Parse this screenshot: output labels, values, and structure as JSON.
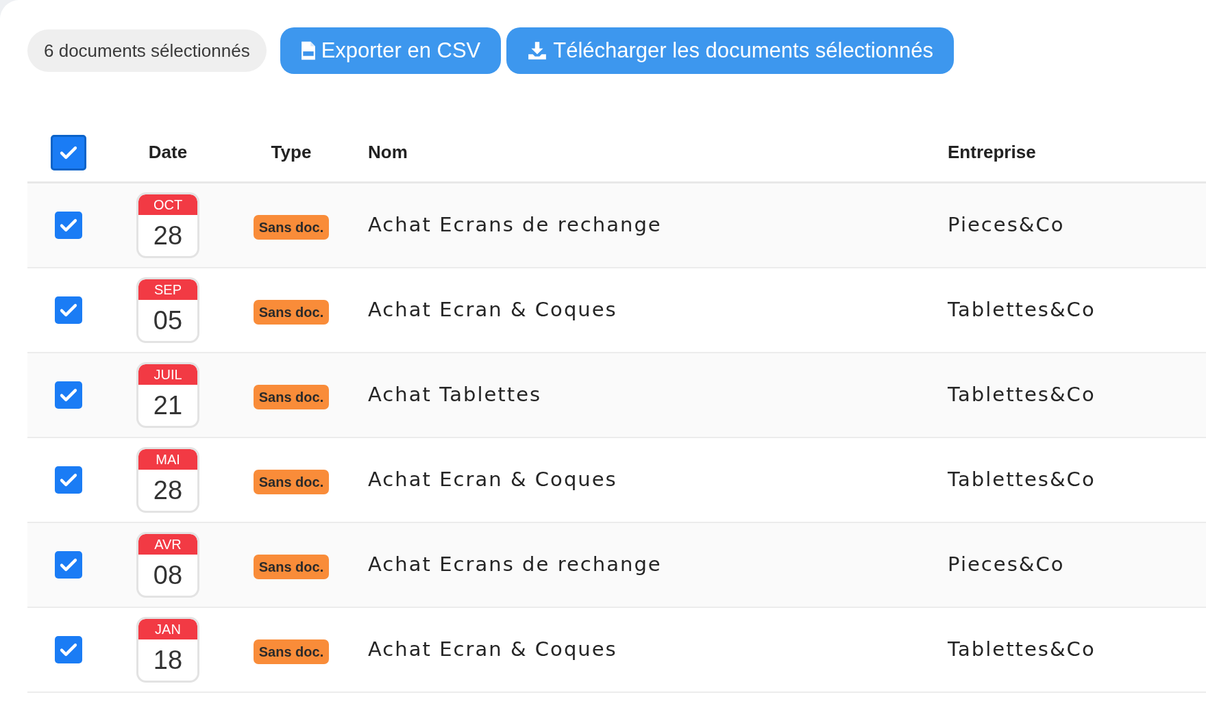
{
  "selection_count": "6 documents sélectionnés",
  "actions": [
    {
      "kind": "csv",
      "label": "Exporter en CSV"
    },
    {
      "kind": "download",
      "label": "Télécharger les documents sélectionnés"
    }
  ],
  "table": {
    "select_all": {
      "checked": true
    },
    "columns": [
      "Date",
      "Type",
      "Nom",
      "Entreprise"
    ],
    "rows": [
      {
        "checked": true,
        "month": "OCT",
        "day": "28",
        "type": "Sans doc.",
        "name": "Achat Ecrans de rechange",
        "company": "Pieces&Co"
      },
      {
        "checked": true,
        "month": "SEP",
        "day": "05",
        "type": "Sans doc.",
        "name": "Achat Ecran & Coques",
        "company": "Tablettes&Co"
      },
      {
        "checked": true,
        "month": "JUIL",
        "day": "21",
        "type": "Sans doc.",
        "name": "Achat Tablettes",
        "company": "Tablettes&Co"
      },
      {
        "checked": true,
        "month": "MAI",
        "day": "28",
        "type": "Sans doc.",
        "name": "Achat Ecran & Coques",
        "company": "Tablettes&Co"
      },
      {
        "checked": true,
        "month": "AVR",
        "day": "08",
        "type": "Sans doc.",
        "name": "Achat Ecrans de rechange",
        "company": "Pieces&Co"
      },
      {
        "checked": true,
        "month": "JAN",
        "day": "18",
        "type": "Sans doc.",
        "name": "Achat Ecran & Coques",
        "company": "Tablettes&Co"
      }
    ]
  }
}
